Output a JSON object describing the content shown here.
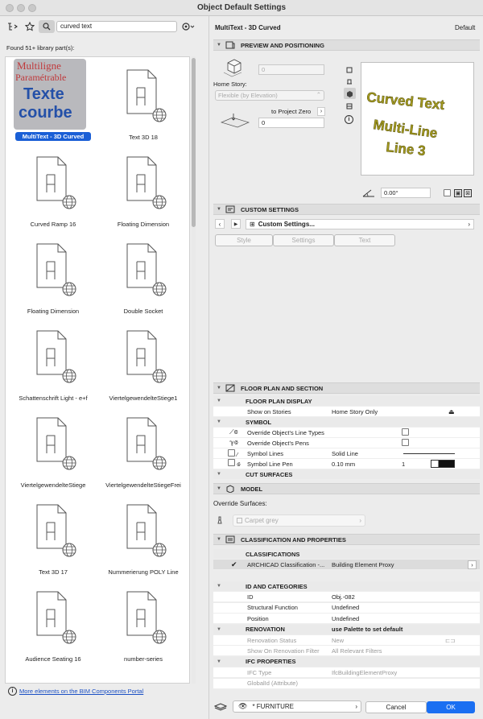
{
  "window": {
    "title": "Object Default Settings"
  },
  "left": {
    "search_value": "curved text",
    "found_label": "Found 51+ library part(s):",
    "link_text": "More elements on the BIM Components Portal",
    "thumb_text": [
      "Multiligne",
      "Paramétrable",
      "Texte",
      "courbe"
    ],
    "items": [
      {
        "label": "MultiText - 3D Curved"
      },
      {
        "label": "Text 3D 18"
      },
      {
        "label": "Curved Ramp 16"
      },
      {
        "label": "Floating Dimension"
      },
      {
        "label": "Floating Dimension"
      },
      {
        "label": "Double Socket"
      },
      {
        "label": "Schattenschrift Light - e+f"
      },
      {
        "label": "ViertelgewendelteStiege1"
      },
      {
        "label": "ViertelgewendelteStiege"
      },
      {
        "label": "ViertelgewendelteStiegeFrei"
      },
      {
        "label": "Text 3D 17"
      },
      {
        "label": "Nummerierung POLY Line"
      },
      {
        "label": "Audience Seating 16"
      },
      {
        "label": "number-series"
      }
    ]
  },
  "right": {
    "object_name": "MultiText - 3D Curved",
    "default_label": "Default",
    "preview": {
      "header": "PREVIEW AND POSITIONING",
      "height_value": "0",
      "home_story_label": "Home Story:",
      "home_story_value": "Flexible (by Elevation)",
      "to_project_zero": "to Project Zero",
      "elevation_value": "0",
      "angle_value": "0.00°",
      "preview_text": [
        "Curved Text",
        "Multi-Line",
        "Line 3"
      ],
      "preview_color": "#a39a1e"
    },
    "custom": {
      "header": "CUSTOM SETTINGS",
      "dropdown": "Custom Settings...",
      "tabs": [
        "Style",
        "Settings",
        "Text"
      ]
    },
    "floor_plan": {
      "header": "FLOOR PLAN AND SECTION",
      "rows": [
        {
          "label": "FLOOR PLAN DISPLAY",
          "value": ""
        },
        {
          "label": "Show on Stories",
          "value": "Home Story Only"
        },
        {
          "label": "SYMBOL",
          "value": ""
        },
        {
          "label": "Override Object's Line Types",
          "value": ""
        },
        {
          "label": "Override Object's Pens",
          "value": ""
        },
        {
          "label": "Symbol Lines",
          "value": "Solid Line"
        },
        {
          "label": "Symbol Line Pen",
          "value": "0.10 mm",
          "extra": "1"
        },
        {
          "label": "CUT SURFACES",
          "value": ""
        }
      ]
    },
    "model": {
      "header": "MODEL",
      "override_label": "Override Surfaces:",
      "surface": "Carpet grey"
    },
    "classification": {
      "header": "CLASSIFICATION AND PROPERTIES",
      "group": "CLASSIFICATIONS",
      "row_label": "ARCHICAD Classification -...",
      "row_value": "Building Element Proxy"
    },
    "properties": {
      "rows": [
        {
          "label": "ID AND CATEGORIES",
          "value": "",
          "group": true
        },
        {
          "label": "ID",
          "value": "Obj.-082"
        },
        {
          "label": "Structural Function",
          "value": "Undefined"
        },
        {
          "label": "Position",
          "value": "Undefined"
        },
        {
          "label": "RENOVATION",
          "value": "use Palette to set default",
          "group": true
        },
        {
          "label": "Renovation Status",
          "value": "New",
          "dim": true
        },
        {
          "label": "Show On Renovation Filter",
          "value": "All Relevant Filters",
          "dim": true
        },
        {
          "label": "IFC PROPERTIES",
          "value": "",
          "group": true
        },
        {
          "label": "IFC Type",
          "value": "IfcBuildingElementProxy",
          "dim": true
        },
        {
          "label": "GlobalId (Attribute)",
          "value": "",
          "dim": true
        }
      ]
    },
    "footer": {
      "layer": "* FURNITURE",
      "cancel": "Cancel",
      "ok": "OK"
    }
  }
}
